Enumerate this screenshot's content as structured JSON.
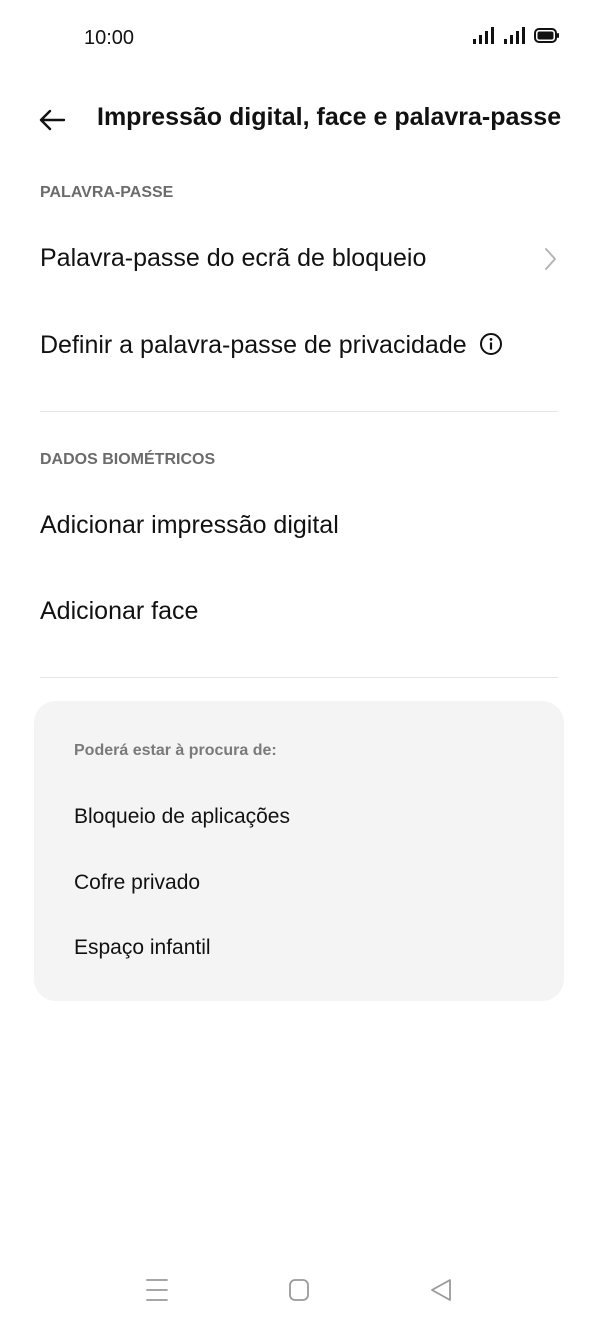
{
  "status_bar": {
    "time": "10:00",
    "icons": [
      "signal-icon",
      "signal-icon",
      "battery-icon"
    ]
  },
  "app_bar": {
    "back_icon": "arrow-left-icon",
    "title": "Impressão digital, face e palavra-passe"
  },
  "sections": {
    "password": {
      "header": "PALAVRA-PASSE",
      "items": [
        {
          "label": "Palavra-passe do ecrã de bloqueio",
          "icon": "chevron-right-icon"
        },
        {
          "label": "Definir a palavra-passe de privacidade",
          "icon": "info-icon"
        }
      ]
    },
    "biometrics": {
      "header": "DADOS BIOMÉTRICOS",
      "items": [
        {
          "label": "Adicionar impressão digital"
        },
        {
          "label": "Adicionar face"
        }
      ]
    }
  },
  "suggestions": {
    "title": "Poderá estar à procura de:",
    "links": [
      "Bloqueio de aplicações",
      "Cofre privado",
      "Espaço infantil"
    ]
  },
  "nav_bar": {
    "icons": [
      "menu-icon",
      "home-icon",
      "back-triangle-icon"
    ]
  },
  "colors": {
    "background": "#ffffff",
    "text": "#111111",
    "section_header": "#6b6b6b",
    "card_background": "#f4f4f4",
    "divider": "#e6e6e6"
  }
}
